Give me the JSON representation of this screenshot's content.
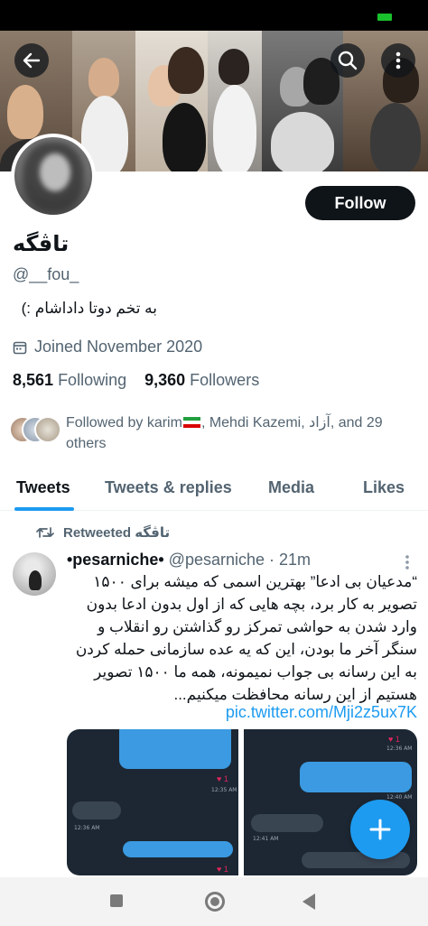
{
  "profile": {
    "display_name": "تاڤگه",
    "handle": "@__fou_",
    "bio": "به تخم دوتا داداشام :)",
    "joined": "Joined November 2020",
    "following_count": "8,561",
    "following_label": "Following",
    "followers_count": "9,360",
    "followers_label": "Followers",
    "followed_by_prefix": "Followed by karim",
    "followed_by_rest": ", Mehdi Kazemi, آزاد, and 29 others",
    "follow_button": "Follow"
  },
  "tabs": [
    {
      "label": "Tweets",
      "active": true
    },
    {
      "label": "Tweets & replies",
      "active": false
    },
    {
      "label": "Media",
      "active": false
    },
    {
      "label": "Likes",
      "active": false
    }
  ],
  "tweet": {
    "retweet_label": "Retweeted تاڤگه",
    "author_name": "•pesarniche•",
    "author_handle": "@pesarniche · 21m",
    "text": "“مدعیان بی ادعا” بهترین اسمی که میشه برای ۱۵۰۰ تصویر به کار برد، بچه هایی که از اول بدون ادعا بدون وارد شدن به حواشی تمرکز رو گذاشتن رو انقلاب و سنگر آخر ما بودن، این که یه عده سازمانی حمله کردن به این رسانه بی جواب نمیمونه، همه ما ۱۵۰۰ تصویر هستیم از این رسانه محافظت میکنیم...",
    "link": "pic.twitter.com/Mji2z5ux7K"
  },
  "icons": {
    "back": "back-arrow-icon",
    "search": "search-icon",
    "more": "more-vertical-icon",
    "calendar": "calendar-icon",
    "retweet": "retweet-icon",
    "compose": "compose-plus-icon"
  },
  "colors": {
    "accent": "#1d9bf0",
    "text_primary": "#0f1419",
    "text_secondary": "#536471",
    "follow_bg": "#0f1419"
  }
}
